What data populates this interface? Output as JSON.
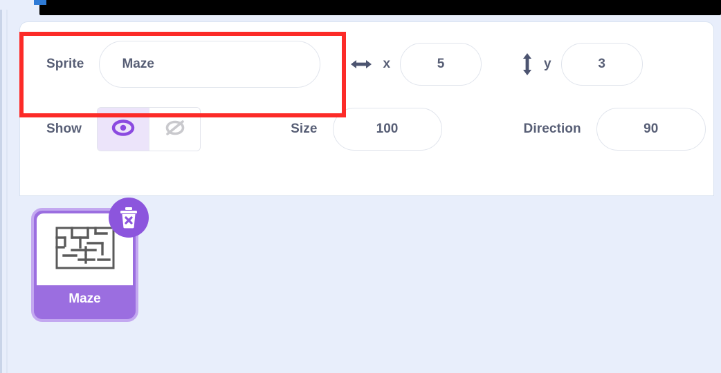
{
  "window": {
    "top_bar_color": "#000000",
    "accent_blue": "#2f7bd6",
    "background_color": "#e8eefb"
  },
  "sprite_info": {
    "sprite_label": "Sprite",
    "sprite_name": "Maze",
    "sprite_name_placeholder": "Sprite name",
    "x_icon": "horizontal-double-arrow-icon",
    "x_label": "x",
    "x_value": "5",
    "y_icon": "vertical-double-arrow-icon",
    "y_label": "y",
    "y_value": "3",
    "show_label": "Show",
    "show_visible_icon": "eye-icon",
    "show_hidden_icon": "eye-slash-icon",
    "show_state": "visible",
    "size_label": "Size",
    "size_value": "100",
    "direction_label": "Direction",
    "direction_value": "90"
  },
  "sprite_list": {
    "tiles": [
      {
        "name": "Maze",
        "selected": true,
        "thumbnail": "maze-thumbnail",
        "delete_icon": "trash-delete-icon"
      }
    ]
  },
  "annotation": {
    "color": "#fc2b28",
    "target": "sprite-name-field"
  }
}
